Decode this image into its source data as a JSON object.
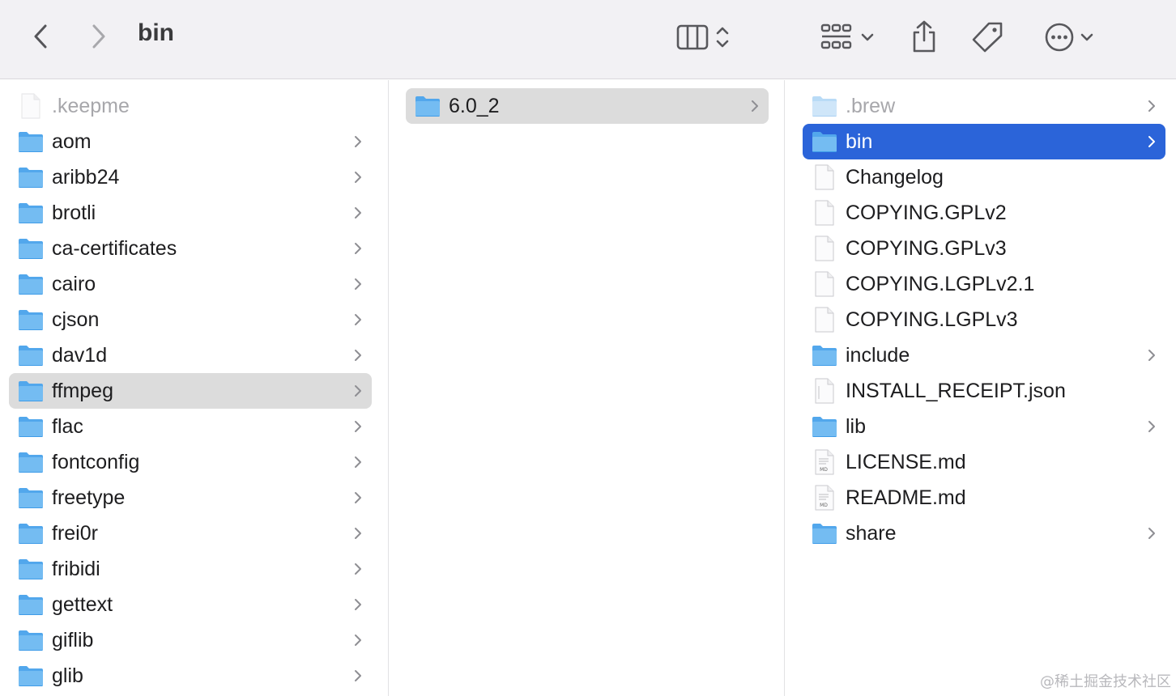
{
  "window": {
    "title": "bin"
  },
  "toolbar": {
    "back_icon": "chevron-left-icon",
    "forward_icon": "chevron-right-icon",
    "view_icon": "columns-view-icon",
    "group_icon": "grid-group-icon",
    "share_icon": "share-icon",
    "tag_icon": "tag-icon",
    "more_icon": "ellipsis-circle-icon"
  },
  "columns": [
    {
      "items": [
        {
          "label": ".keepme",
          "kind": "file",
          "dim": true,
          "chevron": false
        },
        {
          "label": "aom",
          "kind": "folder",
          "chevron": true
        },
        {
          "label": "aribb24",
          "kind": "folder",
          "chevron": true
        },
        {
          "label": "brotli",
          "kind": "folder",
          "chevron": true
        },
        {
          "label": "ca-certificates",
          "kind": "folder",
          "chevron": true
        },
        {
          "label": "cairo",
          "kind": "folder",
          "chevron": true
        },
        {
          "label": "cjson",
          "kind": "folder",
          "chevron": true
        },
        {
          "label": "dav1d",
          "kind": "folder",
          "chevron": true
        },
        {
          "label": "ffmpeg",
          "kind": "folder",
          "chevron": true,
          "selected": "inactive"
        },
        {
          "label": "flac",
          "kind": "folder",
          "chevron": true
        },
        {
          "label": "fontconfig",
          "kind": "folder",
          "chevron": true
        },
        {
          "label": "freetype",
          "kind": "folder",
          "chevron": true
        },
        {
          "label": "frei0r",
          "kind": "folder",
          "chevron": true
        },
        {
          "label": "fribidi",
          "kind": "folder",
          "chevron": true
        },
        {
          "label": "gettext",
          "kind": "folder",
          "chevron": true
        },
        {
          "label": "giflib",
          "kind": "folder",
          "chevron": true
        },
        {
          "label": "glib",
          "kind": "folder",
          "chevron": true
        }
      ]
    },
    {
      "items": [
        {
          "label": "6.0_2",
          "kind": "folder",
          "chevron": true,
          "selected": "inactive"
        }
      ]
    },
    {
      "items": [
        {
          "label": ".brew",
          "kind": "folder",
          "dim": true,
          "chevron": true
        },
        {
          "label": "bin",
          "kind": "folder",
          "chevron": true,
          "selected": "active"
        },
        {
          "label": "Changelog",
          "kind": "file",
          "chevron": false
        },
        {
          "label": "COPYING.GPLv2",
          "kind": "file",
          "chevron": false
        },
        {
          "label": "COPYING.GPLv3",
          "kind": "file",
          "chevron": false
        },
        {
          "label": "COPYING.LGPLv2.1",
          "kind": "file",
          "chevron": false
        },
        {
          "label": "COPYING.LGPLv3",
          "kind": "file",
          "chevron": false
        },
        {
          "label": "include",
          "kind": "folder",
          "chevron": true
        },
        {
          "label": "INSTALL_RECEIPT.json",
          "kind": "json",
          "chevron": false
        },
        {
          "label": "lib",
          "kind": "folder",
          "chevron": true
        },
        {
          "label": "LICENSE.md",
          "kind": "md",
          "chevron": false
        },
        {
          "label": "README.md",
          "kind": "md",
          "chevron": false
        },
        {
          "label": "share",
          "kind": "folder",
          "chevron": true
        }
      ]
    }
  ],
  "colors": {
    "selection_active": "#2b64d9",
    "selection_inactive": "#dcdcdc",
    "folder": "#3f9ce8",
    "toolbar_bg": "#f2f1f4"
  },
  "watermark": "@稀土掘金技术社区"
}
